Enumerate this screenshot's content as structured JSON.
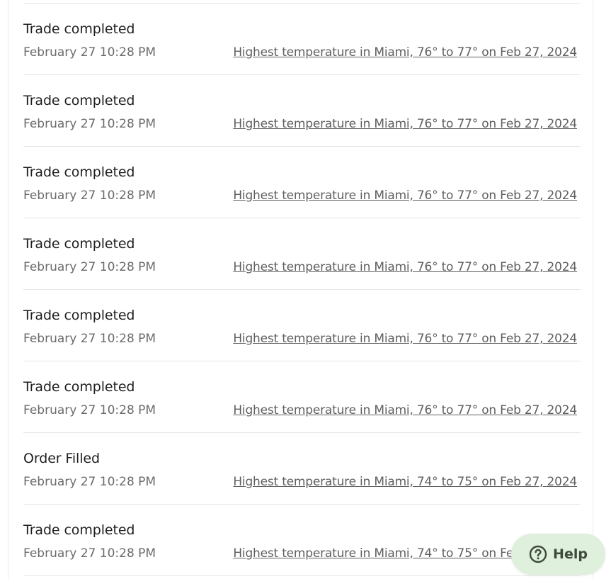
{
  "activity": {
    "rows": [
      {
        "title": "Trade completed",
        "time": "February 27 10:28 PM",
        "market": "Highest temperature in Miami, 76° to 77° on Feb 27, 2024"
      },
      {
        "title": "Trade completed",
        "time": "February 27 10:28 PM",
        "market": "Highest temperature in Miami, 76° to 77° on Feb 27, 2024"
      },
      {
        "title": "Trade completed",
        "time": "February 27 10:28 PM",
        "market": "Highest temperature in Miami, 76° to 77° on Feb 27, 2024"
      },
      {
        "title": "Trade completed",
        "time": "February 27 10:28 PM",
        "market": "Highest temperature in Miami, 76° to 77° on Feb 27, 2024"
      },
      {
        "title": "Trade completed",
        "time": "February 27 10:28 PM",
        "market": "Highest temperature in Miami, 76° to 77° on Feb 27, 2024"
      },
      {
        "title": "Trade completed",
        "time": "February 27 10:28 PM",
        "market": "Highest temperature in Miami, 76° to 77° on Feb 27, 2024"
      },
      {
        "title": "Order Filled",
        "time": "February 27 10:28 PM",
        "market": "Highest temperature in Miami, 74° to 75° on Feb 27, 2024"
      },
      {
        "title": "Trade completed",
        "time": "February 27 10:28 PM",
        "market": "Highest temperature in Miami, 74° to 75° on Feb 27, 2024"
      }
    ]
  },
  "help_button": {
    "label": "Help",
    "icon": "question-circle-icon",
    "background": "#dff0dc"
  },
  "colors": {
    "title": "#1f1f1f",
    "secondary": "#6b6b6b",
    "link": "#5f5f5f",
    "divider": "#e6e6e6"
  }
}
